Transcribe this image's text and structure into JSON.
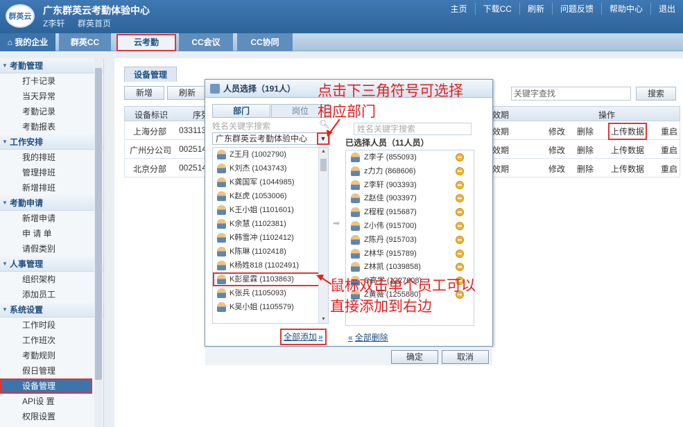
{
  "header": {
    "logo_text": "群英云",
    "title": "广东群英云考勤体验中心",
    "user": "Z李轩",
    "home": "群英首页",
    "links": [
      "主页",
      "下载CC",
      "刷新",
      "问题反馈",
      "帮助中心",
      "退出"
    ]
  },
  "nav": {
    "my_enterprise": "我的企业",
    "home_glyph": "⌂",
    "tabs": [
      "群英CC",
      "云考勤",
      "CC会议",
      "CC协同"
    ]
  },
  "sidebar": {
    "groups": [
      {
        "title": "考勤管理",
        "items": [
          "打卡记录",
          "当天异常",
          "考勤记录",
          "考勤报表"
        ]
      },
      {
        "title": "工作安排",
        "items": [
          "我的排班",
          "管理排班",
          "新增排班"
        ]
      },
      {
        "title": "考勤申请",
        "items": [
          "新增申请",
          "申 请 单",
          "请假类别"
        ]
      },
      {
        "title": "人事管理",
        "items": [
          "组织架构",
          "添加员工"
        ]
      },
      {
        "title": "系统设置",
        "items": [
          "工作时段",
          "工作班次",
          "考勤规则",
          "假日管理",
          "设备管理",
          "API设 置",
          "权限设置"
        ]
      }
    ]
  },
  "main": {
    "tab": "设备管理",
    "toolbar": {
      "add": "新增",
      "refresh": "刷新"
    },
    "keyword_placeholder": "关键字查找",
    "search": "搜索",
    "columns": {
      "id": "设备标识",
      "serial": "序列",
      "period": "效期",
      "ops": "操作"
    },
    "rows": [
      {
        "id": "上海分部",
        "serial": "033113",
        "period": "效期",
        "edit": "修改",
        "del": "删除",
        "upload": "上传数据",
        "restart": "重启"
      },
      {
        "id": "广州分公司",
        "serial": "002514",
        "period": "效期",
        "edit": "修改",
        "del": "删除",
        "upload": "上传数据",
        "restart": "重启"
      },
      {
        "id": "北京分部",
        "serial": "002514",
        "period": "效期",
        "edit": "修改",
        "del": "删除",
        "upload": "上传数据",
        "restart": "重启"
      }
    ]
  },
  "dialog": {
    "title": "人员选择（191人）",
    "tabs": {
      "dept": "部门",
      "post": "岗位"
    },
    "search_placeholder": "姓名关键字搜索",
    "right_search_placeholder": "姓名关键字搜索",
    "dept_value": "广东群英云考勤体验中心",
    "left_people": [
      "Z王月 (1002790)",
      "K刘杰 (1043743)",
      "K龚国军 (1044985)",
      "K赵虎 (1053006)",
      "K王小姐 (1101601)",
      "K余慧 (1102381)",
      "K韩雪冲 (1102412)",
      "K陈琳 (1102418)",
      "K杨姓818 (1102491)",
      "K彭星霖 (1103863)",
      "K张兵 (1105093)",
      "K吴小姐 (1105579)"
    ],
    "right_title": "已选择人员（11人员）",
    "right_people": [
      "Z李子 (855093)",
      "z力力 (868606)",
      "Z李轩 (903393)",
      "Z赵佳 (903397)",
      "Z程程 (915687)",
      "Z小伟 (915700)",
      "Z陈丹 (915703)",
      "Z林华 (915789)",
      "Z林凯 (1039858)",
      "C高学 (1227608)",
      "Z黄薇 (1255880)"
    ],
    "add_all": "全部添加",
    "remove_all": "全部删除",
    "ok": "确定",
    "cancel": "取消"
  },
  "annotations": {
    "a_line1": "点击下三角符号可选择",
    "a_line2": "相应部门",
    "b_line1": "鼠标双击单个员工可以",
    "b_line2": "直接添加到右边"
  },
  "colors": {
    "header": "#3f78b4",
    "highlight": "#e03434",
    "annotation": "#e02020"
  }
}
